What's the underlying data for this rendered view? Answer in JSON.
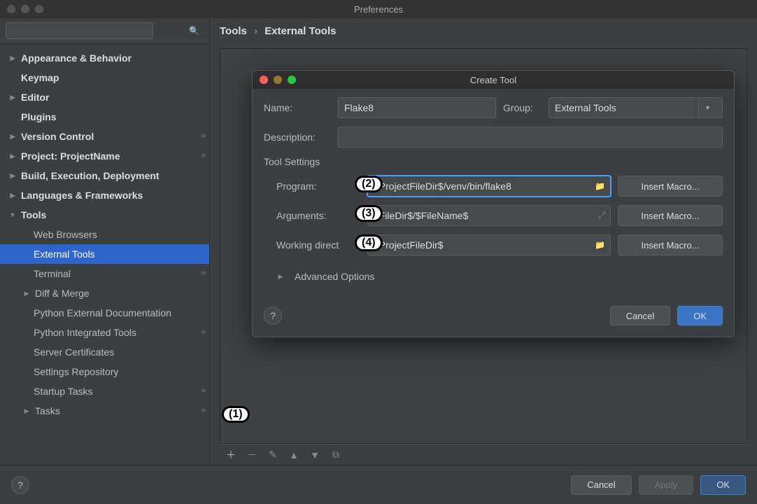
{
  "window": {
    "title": "Preferences"
  },
  "search": {
    "placeholder": ""
  },
  "tree": {
    "appearance": "Appearance & Behavior",
    "keymap": "Keymap",
    "editor": "Editor",
    "plugins": "Plugins",
    "version_control": "Version Control",
    "project": "Project: ProjectName",
    "build": "Build, Execution, Deployment",
    "languages": "Languages & Frameworks",
    "tools": "Tools",
    "tools_children": {
      "web_browsers": "Web Browsers",
      "external_tools": "External Tools",
      "terminal": "Terminal",
      "diff_merge": "Diff & Merge",
      "python_ext_doc": "Python External Documentation",
      "python_int_tools": "Python Integrated Tools",
      "server_cert": "Server Certificates",
      "settings_repo": "Settings Repository",
      "startup_tasks": "Startup Tasks",
      "tasks": "Tasks"
    }
  },
  "breadcrumb": {
    "root": "Tools",
    "leaf": "External Tools"
  },
  "dialog": {
    "title": "Create Tool",
    "name_label": "Name:",
    "name_value": "Flake8",
    "group_label": "Group:",
    "group_value": "External Tools",
    "description_label": "Description:",
    "description_value": "",
    "tool_settings_label": "Tool Settings",
    "program_label": "Program:",
    "program_value": "$ProjectFileDir$/venv/bin/flake8",
    "arguments_label": "Arguments:",
    "arguments_value": "$FileDir$/$FileName$",
    "workdir_label": "Working direct",
    "workdir_value": "$ProjectFileDir$",
    "macro_button": "Insert Macro...",
    "advanced_label": "Advanced Options",
    "cancel": "Cancel",
    "ok": "OK"
  },
  "footer": {
    "cancel": "Cancel",
    "apply": "Apply",
    "ok": "OK"
  },
  "callouts": {
    "c1": "(1)",
    "c2": "(2)",
    "c3": "(3)",
    "c4": "(4)"
  }
}
